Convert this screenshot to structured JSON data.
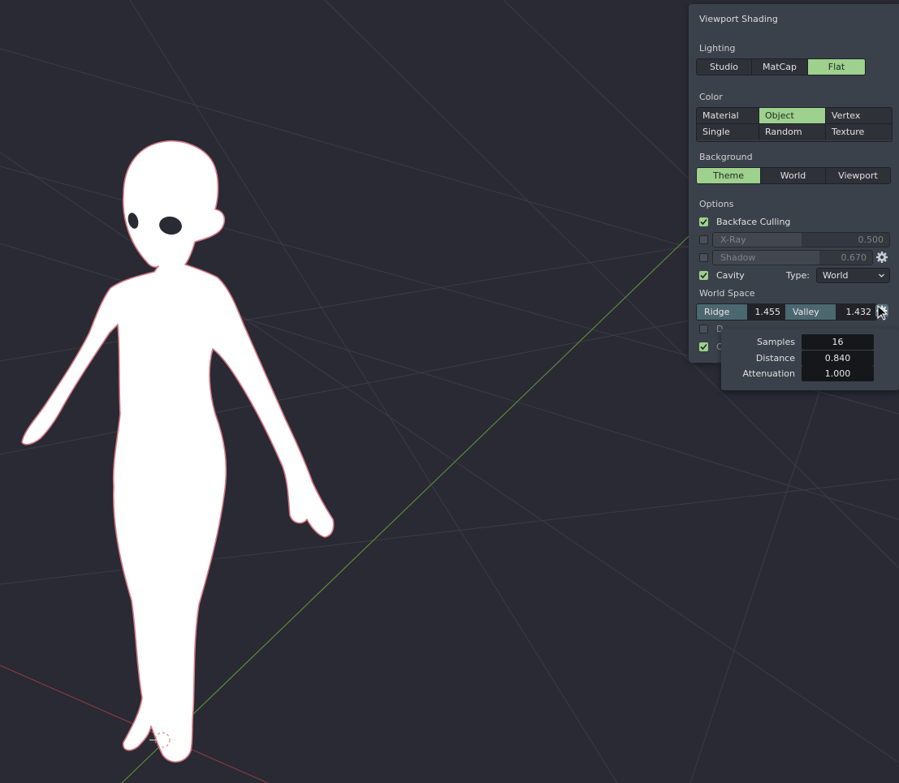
{
  "panel": {
    "title": "Viewport Shading",
    "lighting": {
      "label": "Lighting",
      "options": [
        "Studio",
        "MatCap",
        "Flat"
      ],
      "selected": "Flat"
    },
    "color": {
      "label": "Color",
      "options": [
        "Material",
        "Object",
        "Vertex",
        "Single",
        "Random",
        "Texture"
      ],
      "selected": "Object"
    },
    "background": {
      "label": "Background",
      "options": [
        "Theme",
        "World",
        "Viewport"
      ],
      "selected": "Theme"
    },
    "options": {
      "label": "Options",
      "backface_culling": {
        "label": "Backface Culling",
        "checked": true
      },
      "xray": {
        "label": "X-Ray",
        "value": "0.500",
        "checked": false,
        "fraction": 0.5
      },
      "shadow": {
        "label": "Shadow",
        "value": "0.670",
        "checked": false,
        "fraction": 0.67
      },
      "cavity": {
        "label": "Cavity",
        "checked": true,
        "type_label": "Type:",
        "type_value": "World"
      },
      "world_space": {
        "label": "World Space",
        "ridge_label": "Ridge",
        "ridge_value": "1.455",
        "valley_label": "Valley",
        "valley_value": "1.432"
      },
      "depth_of_field": {
        "label_partial": "D",
        "checked": false
      },
      "outline": {
        "label_partial": "O",
        "checked": true
      }
    }
  },
  "popup": {
    "rows": [
      {
        "label": "Samples",
        "value": "16"
      },
      {
        "label": "Distance",
        "value": "0.840"
      },
      {
        "label": "Attenuation",
        "value": "1.000"
      }
    ]
  },
  "colors": {
    "background": "#292a33",
    "panel": "#3b414a",
    "accent_green": "#9ed08e",
    "grid_line": "#3a3c46",
    "x_axis": "#8a3a42",
    "y_axis": "#5a8a3a",
    "figure_fill": "#ffffff",
    "figure_outline": "#d97a86"
  },
  "icons": [
    "gear-icon",
    "checkmark-icon",
    "chevron-down-icon",
    "mouse-cursor-icon",
    "3d-cursor-icon"
  ]
}
